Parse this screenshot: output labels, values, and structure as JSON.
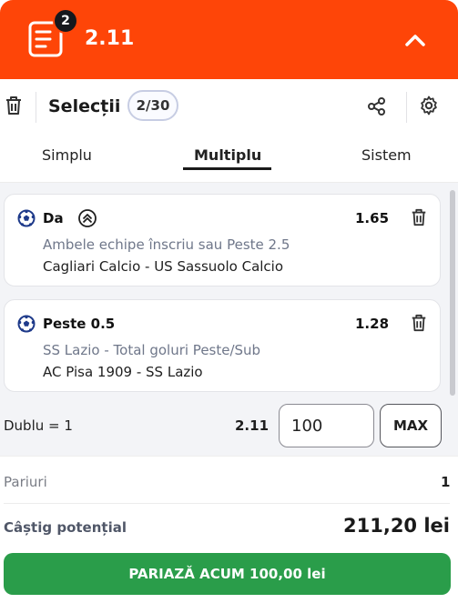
{
  "colors": {
    "header_bg": "#fe4508",
    "badge_bg": "#16181d",
    "bet_button_bg": "#2a9d4a",
    "list_bg": "#f3f4f7"
  },
  "header": {
    "badge_count": "2",
    "total_odds": "2.11",
    "icon": "betslip-icon",
    "collapse_icon": "chevron-up-icon"
  },
  "toolbar": {
    "title": "Selecții",
    "count": "2/30",
    "icons": [
      "trash-icon",
      "share-icon",
      "gear-icon"
    ]
  },
  "tabs": [
    {
      "label": "Simplu",
      "active": false
    },
    {
      "label": "Multiplu",
      "active": true
    },
    {
      "label": "Sistem",
      "active": false
    }
  ],
  "selections": [
    {
      "pick": "Da",
      "odds": "1.65",
      "market": "Ambele echipe înscriu sau Peste 2.5",
      "event": "Cagliari Calcio - US Sassuolo Calcio",
      "has_boost_icon": true
    },
    {
      "pick": "Peste 0.5",
      "odds": "1.28",
      "market": "SS Lazio - Total goluri Peste/Sub",
      "event": "AC Pisa 1909 - SS Lazio",
      "has_boost_icon": false
    }
  ],
  "stake": {
    "combo_label": "Dublu = 1",
    "combo_odds": "2.11",
    "value": "100",
    "max_label": "MAX"
  },
  "summary": {
    "pariuri_label": "Pariuri",
    "pariuri_value": "1",
    "castig_label": "Câștig potențial",
    "castig_value": "211,20 lei",
    "bet_button_label": "PARIAZĂ ACUM 100,00 lei"
  }
}
